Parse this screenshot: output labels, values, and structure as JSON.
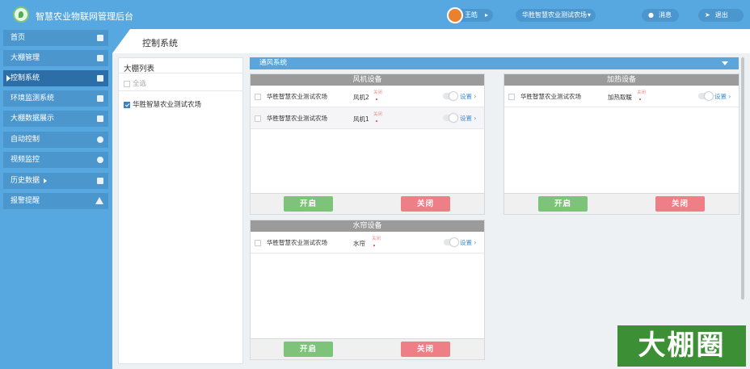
{
  "app": {
    "title": "智慧农业物联网管理后台",
    "user_name": "王皓",
    "current_farm": "华胜智慧农业测试农场",
    "messages_label": "消息",
    "logout_label": "退出"
  },
  "sidebar": {
    "items": [
      {
        "label": "首页",
        "icon": "home-icon"
      },
      {
        "label": "大棚管理",
        "icon": "greenhouse-icon"
      },
      {
        "label": "控制系统",
        "icon": "grid-icon",
        "active": true
      },
      {
        "label": "环境监测系统",
        "icon": "monitor-icon"
      },
      {
        "label": "大棚数据展示",
        "icon": "monitor-icon"
      },
      {
        "label": "自动控制",
        "icon": "gear-icon"
      },
      {
        "label": "视频监控",
        "icon": "camera-icon"
      },
      {
        "label": "历史数据",
        "icon": "document-icon",
        "has_submenu": true
      },
      {
        "label": "报警提醒",
        "icon": "warning-icon"
      }
    ]
  },
  "page": {
    "title": "控制系统"
  },
  "greenhouse_list": {
    "title": "大棚列表",
    "select_all_label": "全选",
    "items": [
      {
        "label": "华胜智慧农业测试农场",
        "checked": true
      }
    ]
  },
  "ventilation": {
    "title": "通风系统"
  },
  "panels": {
    "fan": {
      "title": "风机设备",
      "rows": [
        {
          "farm": "华胜智慧农业测试农场",
          "device": "风机2",
          "state": "关闭",
          "settings": "设置"
        },
        {
          "farm": "华胜智慧农业测试农场",
          "device": "风机1",
          "state": "关闭",
          "settings": "设置"
        }
      ],
      "on_label": "开启",
      "off_label": "关闭"
    },
    "heating": {
      "title": "加热设备",
      "rows": [
        {
          "farm": "华胜智慧农业测试农场",
          "device": "加热取暖",
          "state": "关闭",
          "settings": "设置"
        }
      ],
      "on_label": "开启",
      "off_label": "关闭"
    },
    "curtain": {
      "title": "水帘设备",
      "rows": [
        {
          "farm": "华胜智慧农业测试农场",
          "device": "水帘",
          "state": "关闭",
          "settings": "设置"
        }
      ],
      "on_label": "开启",
      "off_label": "关闭"
    }
  },
  "watermark": {
    "text": "大棚圈"
  },
  "colors": {
    "primary": "#57a8e0",
    "active_nav": "#2c6fa8",
    "button_on": "#7dc37a",
    "button_off": "#ee7f86",
    "panel_header": "#9b9b9b",
    "watermark_bg": "#3c8f35"
  }
}
